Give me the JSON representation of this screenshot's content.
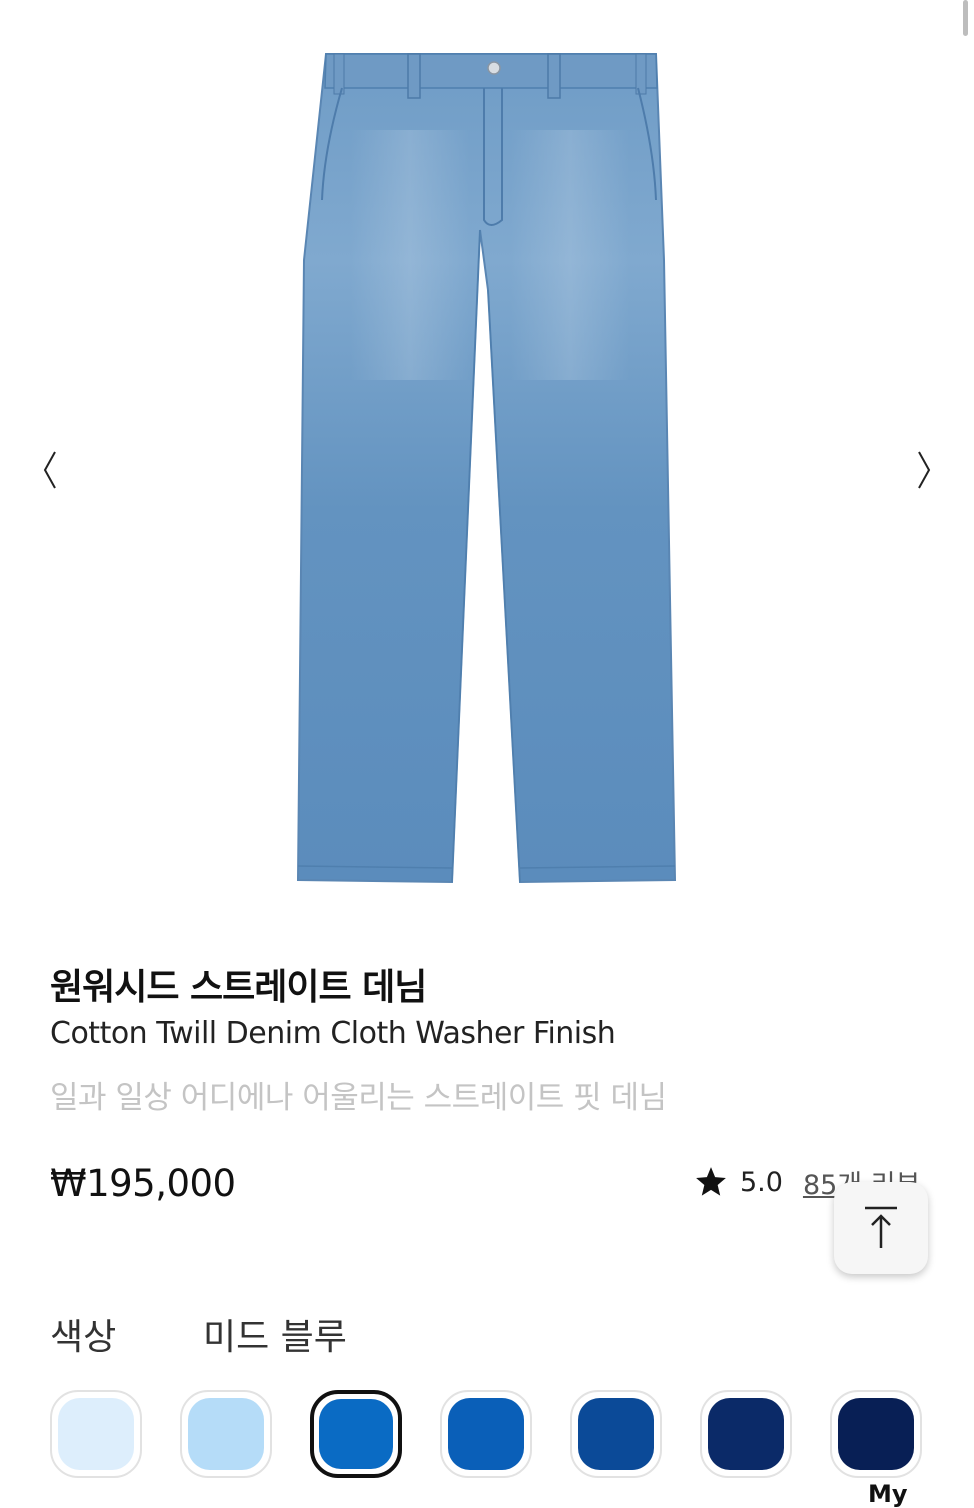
{
  "gallery": {
    "prev_icon": "chevron-left-icon",
    "next_icon": "chevron-right-icon"
  },
  "product": {
    "name_ko": "원워시드 스트레이트 데님",
    "name_en": "Cotton Twill Denim Cloth Washer Finish",
    "subtitle": "일과 일상 어디에나 어울리는 스트레이트 핏 데님",
    "price": "₩195,000",
    "rating": "5.0",
    "review_link": "85개 리뷰"
  },
  "color": {
    "label": "색상",
    "selected": "미드 블루",
    "swatches": [
      {
        "hex": "#ddeefc"
      },
      {
        "hex": "#b5dcf8"
      },
      {
        "hex": "#0a6bc4",
        "selected": true
      },
      {
        "hex": "#0a5fb8"
      },
      {
        "hex": "#0b4a98"
      },
      {
        "hex": "#0b2a68"
      },
      {
        "hex": "#081f55"
      }
    ]
  },
  "scroll_top_icon": "arrow-up-to-top-icon",
  "bottom_nav": {
    "my_label": "My"
  }
}
